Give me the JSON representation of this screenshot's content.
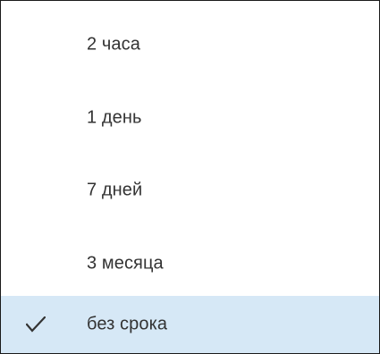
{
  "menu": {
    "items": [
      {
        "label": "2 часа",
        "selected": false
      },
      {
        "label": "1 день",
        "selected": false
      },
      {
        "label": "7 дней",
        "selected": false
      },
      {
        "label": "3 месяца",
        "selected": false
      },
      {
        "label": "без срока",
        "selected": true
      }
    ],
    "check_icon": "checkmark-icon",
    "colors": {
      "selected_background": "#d6e8f6",
      "text": "#333333",
      "border": "#1a1a1a"
    }
  }
}
